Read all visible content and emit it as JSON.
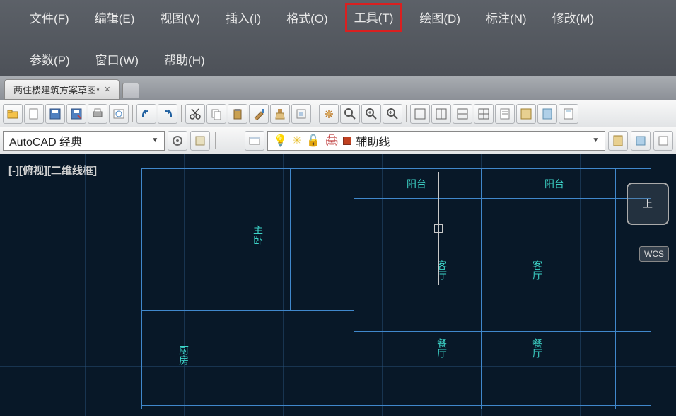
{
  "menu": {
    "row1": [
      {
        "label": "文件(F)",
        "name": "menu-file"
      },
      {
        "label": "编辑(E)",
        "name": "menu-edit"
      },
      {
        "label": "视图(V)",
        "name": "menu-view"
      },
      {
        "label": "插入(I)",
        "name": "menu-insert"
      },
      {
        "label": "格式(O)",
        "name": "menu-format"
      },
      {
        "label": "工具(T)",
        "name": "menu-tools",
        "highlight": true
      },
      {
        "label": "绘图(D)",
        "name": "menu-draw"
      },
      {
        "label": "标注(N)",
        "name": "menu-annotate"
      },
      {
        "label": "修改(M)",
        "name": "menu-modify"
      }
    ],
    "row2": [
      {
        "label": "参数(P)",
        "name": "menu-parametric"
      },
      {
        "label": "窗口(W)",
        "name": "menu-window"
      },
      {
        "label": "帮助(H)",
        "name": "menu-help"
      }
    ]
  },
  "tabs": {
    "active": {
      "label": "两住楼建筑方案草图*"
    }
  },
  "workspace_combo": "AutoCAD 经典",
  "layer_combo": "辅助线",
  "view_label": "[-][俯视][二维线框]",
  "viewcube_face": "上",
  "wcs_label": "WCS",
  "room_labels": {
    "balcony1": "阳台",
    "balcony2": "阳台",
    "master": "主卧",
    "living1": "客厅",
    "living2": "客厅",
    "dining1": "餐厅",
    "dining2": "餐厅",
    "kitchen": "厨房"
  },
  "toolbar_icons": {
    "open": "📂",
    "new": "📄",
    "save": "💾",
    "print": "🖨",
    "settings": "⚙",
    "undo": "↶",
    "redo": "↷",
    "cut": "✂",
    "copy": "📋",
    "paste": "📋",
    "match": "🖌",
    "clean": "🧹",
    "pan": "🖐",
    "zoomwin": "🔍",
    "zoom": "🔍",
    "ext": "🔲",
    "win1": "◫",
    "win2": "▤",
    "win3": "▥",
    "win4": "▦",
    "layer": "📋",
    "gear": "⚙",
    "wrench": "🔧",
    "layerpanel1": "📋",
    "layerpanel2": "📋",
    "layerpanel3": "📋"
  }
}
